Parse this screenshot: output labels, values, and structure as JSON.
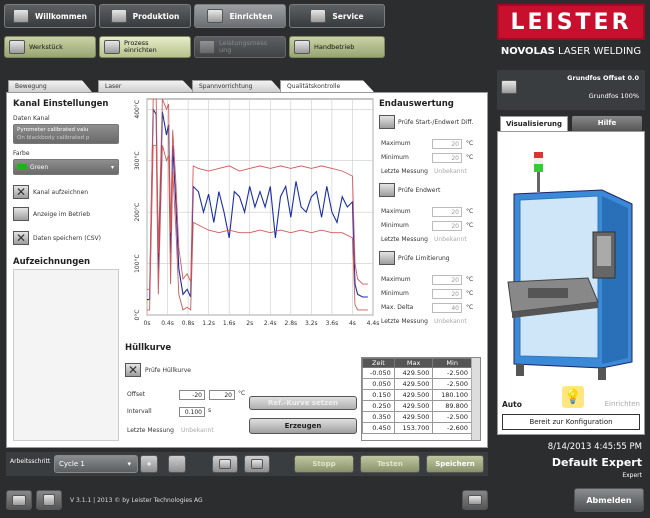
{
  "top_nav": [
    {
      "label": "Willkommen",
      "icon": "home-icon"
    },
    {
      "label": "Produktion",
      "icon": "production-icon"
    },
    {
      "label": "Einrichten",
      "icon": "gears-icon"
    },
    {
      "label": "Service",
      "icon": "wrench-icon"
    }
  ],
  "sub_nav": [
    {
      "label": "Werkstück"
    },
    {
      "label": "Prozess einrichten"
    },
    {
      "label": "Leistungsmessung"
    },
    {
      "label": "Handbetrieb"
    }
  ],
  "brand": {
    "logo": "LEISTER",
    "product_bold": "NOVOLAS",
    "product_rest": "LASER WELDING"
  },
  "tabs": [
    "Bewegung",
    "Laser",
    "Spannvorrichtung",
    "Qualitätskontrolle"
  ],
  "kanal": {
    "title": "Kanal Einstellungen",
    "daten_kanal_label": "Daten Kanal",
    "daten_kanal_value1": "Pyrometer calibrated valu",
    "daten_kanal_value2": "On blackbody calibrated p",
    "farbe_label": "Farbe",
    "farbe_value": "Green",
    "chk1": "Kanal aufzeichnen",
    "chk2": "Anzeige im Betrieb",
    "chk3": "Daten speichern (CSV)"
  },
  "aufzeichnungen": {
    "title": "Aufzeichnungen"
  },
  "chart_data": {
    "type": "line",
    "title": "",
    "xlabel": "",
    "ylabel": "",
    "xlim": [
      0,
      4.4
    ],
    "ylim": [
      0,
      420
    ],
    "x_ticks": [
      "0s",
      "0.4s",
      "0.8s",
      "1.2s",
      "1.6s",
      "2s",
      "2.4s",
      "2.8s",
      "3.2s",
      "3.6s",
      "4s",
      "4.4s"
    ],
    "y_ticks": [
      "0°C",
      "100°C",
      "200°C",
      "300°C",
      "400°C"
    ],
    "grid": true,
    "series": [
      {
        "color": "#1a2fa8",
        "x": [
          0,
          0.05,
          0.12,
          0.18,
          0.22,
          0.3,
          0.38,
          0.42,
          0.46,
          0.5,
          0.56,
          0.62,
          0.7,
          0.78,
          0.85,
          0.9,
          1.0,
          1.1,
          1.2,
          1.3,
          1.4,
          1.5,
          1.6,
          1.7,
          1.8,
          1.9,
          2.0,
          2.1,
          2.2,
          2.3,
          2.4,
          2.5,
          2.6,
          2.7,
          2.8,
          2.9,
          3.0,
          3.1,
          3.2,
          3.3,
          3.4,
          3.5,
          3.6,
          3.7,
          3.8,
          3.9,
          4.0,
          4.05,
          4.1,
          4.2,
          4.3
        ],
        "y": [
          30,
          30,
          400,
          390,
          80,
          395,
          350,
          370,
          120,
          330,
          220,
          90,
          40,
          50,
          35,
          250,
          240,
          200,
          235,
          180,
          240,
          200,
          150,
          240,
          230,
          200,
          250,
          210,
          240,
          210,
          250,
          150,
          230,
          250,
          190,
          260,
          210,
          200,
          230,
          240,
          190,
          250,
          200,
          180,
          230,
          210,
          220,
          60,
          40,
          35,
          35
        ]
      },
      {
        "color": "#d05a5a",
        "x": [
          0,
          0.05,
          0.12,
          0.18,
          0.22,
          0.3,
          0.38,
          0.42,
          0.46,
          0.5,
          0.56,
          0.62,
          0.7,
          0.78,
          0.85,
          0.9,
          1.0,
          1.2,
          1.4,
          1.6,
          1.8,
          2.0,
          2.2,
          2.4,
          2.6,
          2.8,
          3.0,
          3.2,
          3.4,
          3.6,
          3.8,
          4.0,
          4.05,
          4.1,
          4.2,
          4.3
        ],
        "y": [
          50,
          50,
          420,
          420,
          120,
          420,
          400,
          410,
          160,
          360,
          260,
          130,
          70,
          80,
          65,
          290,
          285,
          280,
          285,
          290,
          280,
          285,
          290,
          285,
          290,
          285,
          290,
          285,
          290,
          285,
          280,
          270,
          100,
          70,
          60,
          60
        ]
      },
      {
        "color": "#d05a5a",
        "x": [
          0,
          0.05,
          0.12,
          0.18,
          0.22,
          0.3,
          0.38,
          0.42,
          0.46,
          0.5,
          0.56,
          0.62,
          0.7,
          0.78,
          0.85,
          0.9,
          1.0,
          1.2,
          1.4,
          1.6,
          1.8,
          2.0,
          2.2,
          2.4,
          2.6,
          2.8,
          3.0,
          3.2,
          3.4,
          3.6,
          3.8,
          4.0,
          4.05,
          4.1,
          4.2,
          4.3
        ],
        "y": [
          10,
          10,
          330,
          330,
          40,
          330,
          300,
          310,
          60,
          280,
          170,
          40,
          10,
          15,
          10,
          180,
          175,
          165,
          160,
          165,
          160,
          160,
          165,
          160,
          165,
          160,
          165,
          160,
          165,
          160,
          160,
          150,
          20,
          10,
          10,
          10
        ]
      }
    ]
  },
  "endauswertung": {
    "title": "Endauswertung",
    "chk1": "Prüfe Start-/Endwert Diff.",
    "chk2": "Prüfe Endwert",
    "chk3": "Prüfe Limitierung",
    "maximum": "Maximum",
    "minimum": "Minimum",
    "letzte": "Letzte Messung",
    "max_delta": "Max. Delta",
    "val20": "20",
    "val40": "40",
    "unit_c": "°C",
    "unbekannt": "Unbekannt"
  },
  "huellkurve": {
    "title": "Hüllkurve",
    "chk": "Prüfe Hüllkurve",
    "offset_label": "Offset",
    "offset_a": "-20",
    "offset_b": "20",
    "offset_unit": "°C",
    "intervall_label": "Intervall",
    "intervall_value": "0.100",
    "intervall_unit": "s",
    "letzte_label": "Letzte Messung",
    "letzte_value": "Unbekannt",
    "btn_ref": "Ref.-Kurve setzen",
    "btn_erzeugen": "Erzeugen",
    "table_headers": [
      "Zeit",
      "Max",
      "Min"
    ],
    "table_rows": [
      [
        "-0.050",
        "429.500",
        "-2.500"
      ],
      [
        "0.050",
        "429.500",
        "-2.500"
      ],
      [
        "0.150",
        "429.500",
        "180.100"
      ],
      [
        "0.250",
        "429.500",
        "89.800"
      ],
      [
        "0.350",
        "429.500",
        "-2.500"
      ],
      [
        "0.450",
        "153.700",
        "-2.600"
      ]
    ]
  },
  "bottom_bar": {
    "arbeitsschritt": "Arbeitsschritt",
    "cycle": "Cycle 1",
    "plus": "+",
    "minus": "-",
    "stopp": "Stopp",
    "testen": "Testen",
    "speichern": "Speichern"
  },
  "right": {
    "offset_title": "Grundfos Offset 0.0",
    "offset_sub": "Grundfos 100%",
    "tab_visual": "Visualisierung",
    "tab_hilfe": "Hilfe",
    "auto": "Auto",
    "einrichten": "Einrichten",
    "bereit": "Bereit zur Konfiguration",
    "datetime": "8/14/2013 4:45:55 PM",
    "user": "Default Expert",
    "role": "Expert"
  },
  "footer": {
    "version": "V 3.1.1 | 2013 © by Leister Technologies AG",
    "abmelden": "Abmelden"
  }
}
